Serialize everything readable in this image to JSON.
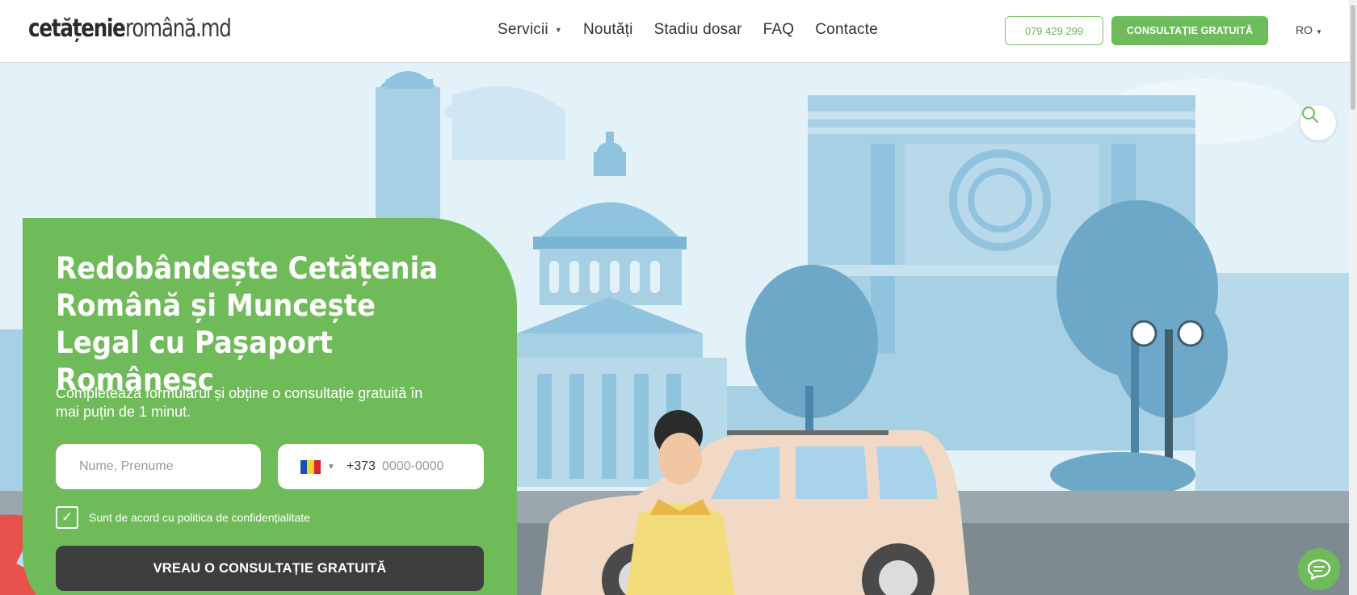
{
  "header": {
    "logo_left": "cetățenie",
    "logo_right": "română.md",
    "nav": [
      {
        "label": "Servicii",
        "has_dropdown": true
      },
      {
        "label": "Noutăți"
      },
      {
        "label": "Stadiu dosar"
      },
      {
        "label": "FAQ"
      },
      {
        "label": "Contacte"
      }
    ],
    "phone_button": "079 429 299",
    "consult_button": "CONSULTAȚIE GRATUITĂ",
    "language": "RO"
  },
  "hero": {
    "title": "Redobândește Cetățenia Română și Muncește Legal cu Pașaport Românesc",
    "subtitle": "Completează formularul și obține o consultație gratuită în mai puțin de 1 minut.",
    "name_placeholder": "Nume, Prenume",
    "phone_prefix": "+373",
    "phone_placeholder": "0000-0000",
    "consent_label": "Sunt de acord cu politica de confidențialitate",
    "consent_checked": true,
    "submit_label": "VREAU O CONSULTAȚIE GRATUITĂ"
  },
  "icons": {
    "search": "search-icon",
    "chat": "chat-icon",
    "checkmark": "check-icon"
  },
  "colors": {
    "brand_green": "#70bb59",
    "dark_button": "#3e3d3d",
    "sky": "#dff0f7",
    "building": "#8fc3de"
  }
}
